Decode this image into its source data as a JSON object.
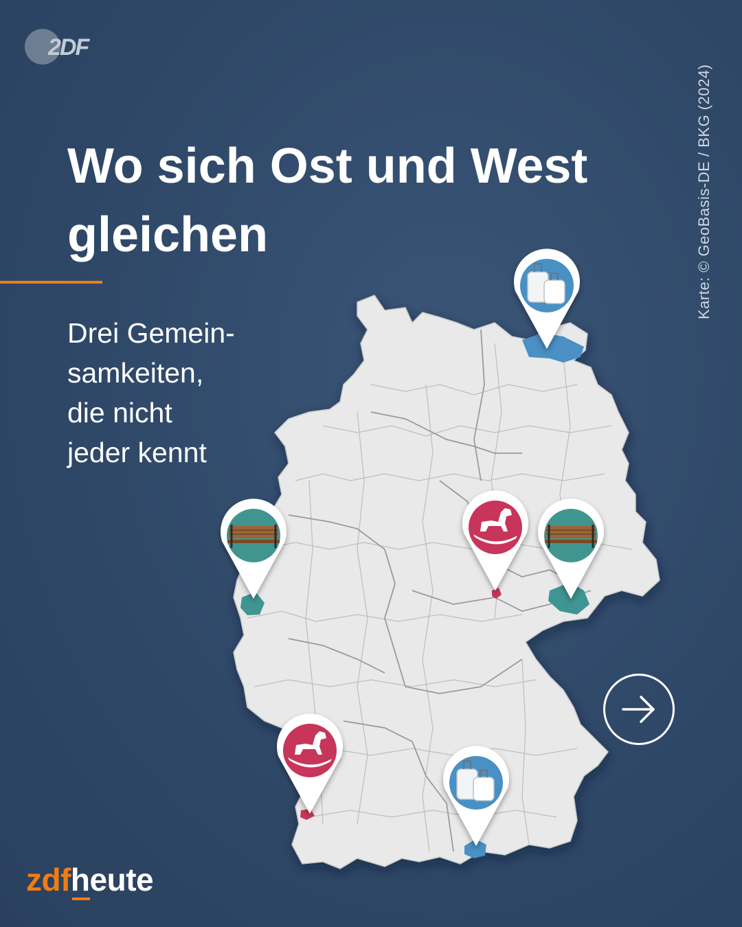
{
  "logo": {
    "text": "2DF"
  },
  "title": "Wo sich Ost und West gleichen",
  "subtitle": "Drei Gemein-\nsamkeiten,\ndie nicht\njeder kennt",
  "credit": "Karte: © GeoBasis-DE / BKG (2024)",
  "brand": {
    "part1": "zdf",
    "part2": "heute"
  },
  "colors": {
    "background": "#2f4868",
    "map_fill": "#e9e9e9",
    "accent_orange": "#f07d14",
    "blue": "#4a90c4",
    "teal": "#3f9591",
    "magenta": "#c8365a"
  },
  "markers": [
    {
      "icon": "suitcase-icon",
      "color": "blue",
      "region": "Nordost (Vorpommern)"
    },
    {
      "icon": "bench-icon",
      "color": "teal",
      "region": "West (Aachen)"
    },
    {
      "icon": "rocking-horse-icon",
      "color": "magenta",
      "region": "Mitte (Thüringen)"
    },
    {
      "icon": "bench-icon",
      "color": "teal",
      "region": "Ost (Sachsen)"
    },
    {
      "icon": "rocking-horse-icon",
      "color": "magenta",
      "region": "Südwest (Baden)"
    },
    {
      "icon": "suitcase-icon",
      "color": "blue",
      "region": "Süd (Oberbayern)"
    }
  ]
}
